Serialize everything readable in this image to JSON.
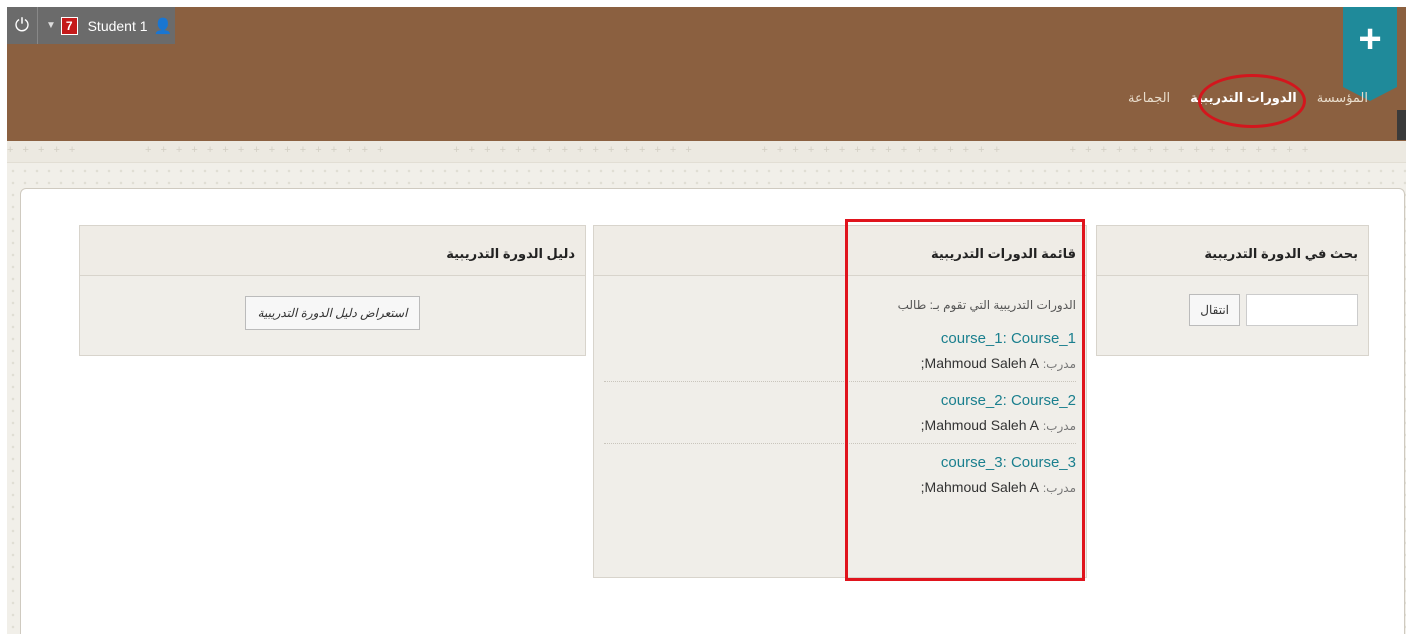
{
  "topbar": {
    "notification_count": "7",
    "user_name": "Student 1"
  },
  "nav": {
    "items": [
      "المؤسسة",
      "الدورات التدريبية",
      "الجماعة"
    ],
    "active": "الدورات التدريبية"
  },
  "search_module": {
    "title": "بحث في الدورة التدريبية",
    "go_label": "انتقال"
  },
  "courses_module": {
    "title": "قائمة الدورات التدريبية",
    "intro": "الدورات التدريبية التي تقوم بـ: طالب",
    "instructor_label": "مدرب:",
    "courses": [
      {
        "name": "course_1: Course_1",
        "instructor": "Mahmoud Saleh A;"
      },
      {
        "name": "course_2: Course_2",
        "instructor": "Mahmoud Saleh A;"
      },
      {
        "name": "course_3: Course_3",
        "instructor": "Mahmoud Saleh A;"
      }
    ]
  },
  "guide_module": {
    "title": "دليل الدورة التدريبية",
    "button_label": "استعراض دليل الدورة التدريبية"
  },
  "colors": {
    "header": "#8b6040",
    "accent": "#1f8a9a",
    "course_link": "#1a7f8e",
    "highlight": "#e0141d"
  }
}
